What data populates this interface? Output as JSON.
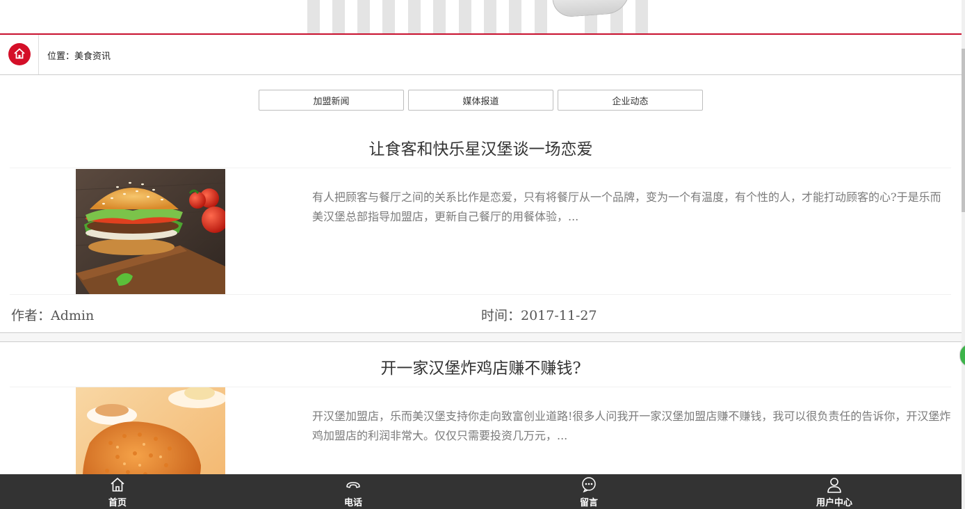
{
  "location": {
    "prefix": "位置：",
    "current": "美食资讯"
  },
  "tabs": [
    {
      "label": "加盟新闻"
    },
    {
      "label": "媒体报道"
    },
    {
      "label": "企业动态"
    }
  ],
  "articles": [
    {
      "title": "让食客和快乐星汉堡谈一场恋爱",
      "image": "burger-photo",
      "excerpt": "有人把顾客与餐厅之间的关系比作是恋爱，只有将餐厅从一个品牌，变为一个有温度，有个性的人，才能打动顾客的心?于是乐而美汉堡总部指导加盟店，更新自己餐厅的用餐体验，...",
      "author": "作者：Admin",
      "time": "时间：2017-11-27"
    },
    {
      "title": "开一家汉堡炸鸡店赚不赚钱?",
      "image": "fried-chicken-photo",
      "excerpt": "开汉堡加盟店，乐而美汉堡支持你走向致富创业道路!很多人问我开一家汉堡加盟店赚不赚钱，我可以很负责任的告诉你，开汉堡炸鸡加盟店的利润非常大。仅仅只需要投资几万元，..."
    }
  ],
  "bottom_nav": [
    {
      "label": "首页",
      "icon": "home-icon"
    },
    {
      "label": "电话",
      "icon": "phone-icon"
    },
    {
      "label": "留言",
      "icon": "message-icon"
    },
    {
      "label": "用户中心",
      "icon": "user-icon"
    }
  ],
  "colors": {
    "accent": "#c8102e",
    "nav_bg": "#333333",
    "text_muted": "#7a7a7a"
  }
}
